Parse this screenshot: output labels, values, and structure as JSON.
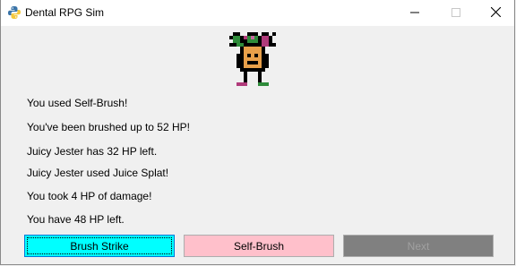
{
  "window": {
    "title": "Dental RPG Sim",
    "icons": {
      "app": "python-icon",
      "minimize": "minimize-icon",
      "maximize": "maximize-icon",
      "close": "close-icon"
    }
  },
  "enemy": {
    "sprite": "jester-sprite"
  },
  "log": [
    "You used Self-Brush!",
    "You've been brushed up to 52 HP!",
    "Juicy Jester has 32 HP left.",
    "Juicy Jester used Juice Splat!",
    "You took 4 HP of damage!",
    "You have 48 HP left."
  ],
  "buttons": {
    "brush_strike": "Brush Strike",
    "self_brush": "Self-Brush",
    "next": "Next"
  },
  "colors": {
    "brush_strike_bg": "#00ffff",
    "self_brush_bg": "#ffc0cb",
    "next_bg": "#808080"
  }
}
